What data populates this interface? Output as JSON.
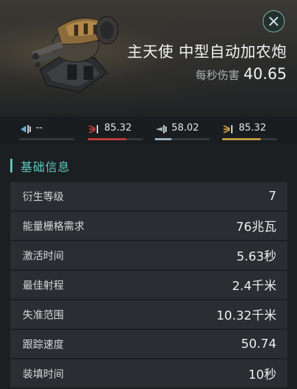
{
  "item": {
    "title": "主天使 中型自动加农炮",
    "dps_label": "每秒伤害",
    "dps_value": "40.65"
  },
  "damage": [
    {
      "icon": "em-damage-icon",
      "value": "--",
      "fill": 0,
      "color": "#6aa8c8"
    },
    {
      "icon": "thermal-damage-icon",
      "value": "85.32",
      "fill": 0.7,
      "color": "#c23a3a"
    },
    {
      "icon": "kinetic-damage-icon",
      "value": "58.02",
      "fill": 0.3,
      "color": "#9fb4c2"
    },
    {
      "icon": "explosive-damage-icon",
      "value": "85.32",
      "fill": 0.7,
      "color": "#c59a42"
    }
  ],
  "section": {
    "title": "基础信息"
  },
  "attributes": [
    {
      "label": "衍生等级",
      "value": "7"
    },
    {
      "label": "能量栅格需求",
      "value": "76兆瓦"
    },
    {
      "label": "激活时间",
      "value": "5.63秒"
    },
    {
      "label": "最佳射程",
      "value": "2.4千米"
    },
    {
      "label": "失准范围",
      "value": "10.32千米"
    },
    {
      "label": "跟踪速度",
      "value": "50.74"
    },
    {
      "label": "装填时间",
      "value": "10秒"
    }
  ],
  "colors": {
    "accent": "#5ec7c0",
    "panel": "#2a2d31"
  }
}
